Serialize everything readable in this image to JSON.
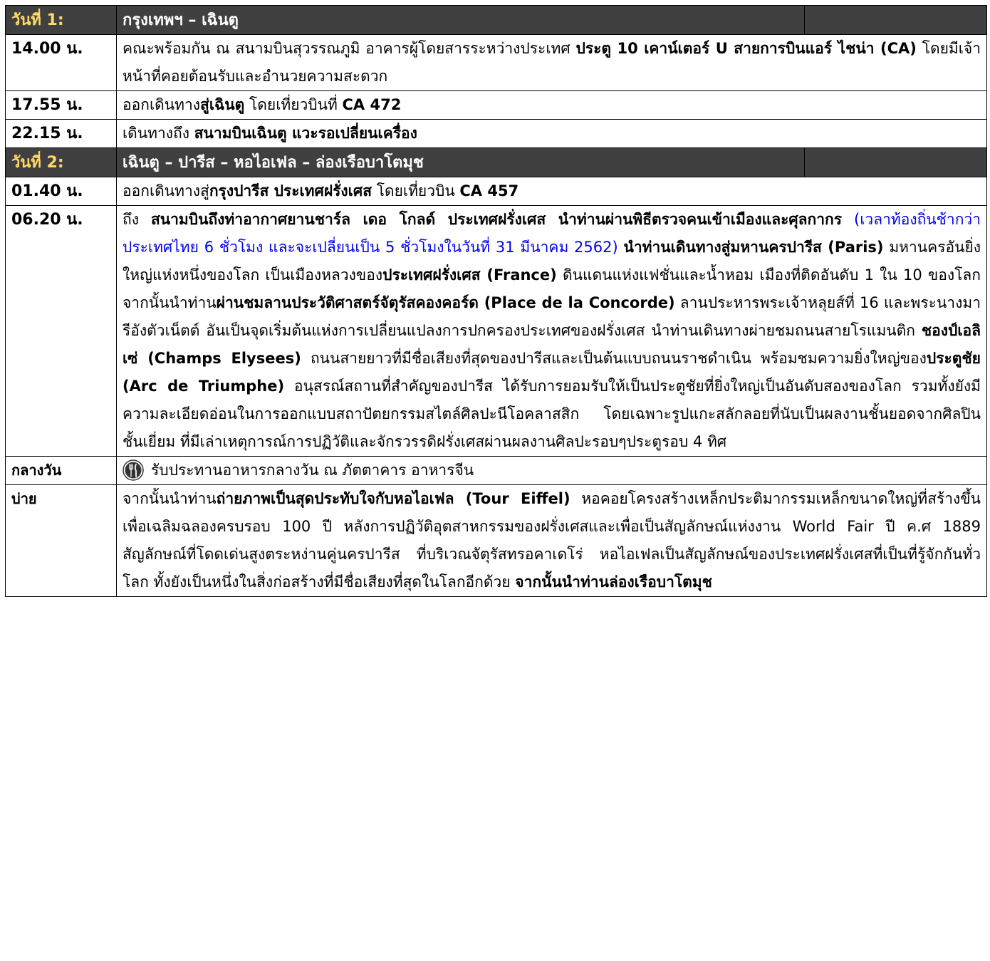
{
  "day1": {
    "label": "วันที่ 1:",
    "title": "กรุงเทพฯ – เฉินตู",
    "rows": [
      {
        "time": "14.00 น.",
        "segments": [
          {
            "t": "คณะพร้อมกัน ณ สนามบินสุวรรณภูมิ อาคารผู้โดยสารระหว่างประเทศ ",
            "s": "n"
          },
          {
            "t": "ประตู 10 เคาน์เตอร์ U สายการบินแอร์ ไชน่า (CA)",
            "s": "b"
          },
          {
            "t": " โดยมีเจ้าหน้าที่คอยต้อนรับและอำนวยความสะดวก",
            "s": "n"
          }
        ]
      },
      {
        "time": "17.55 น.",
        "segments": [
          {
            "t": "ออกเดินทาง",
            "s": "n"
          },
          {
            "t": "สู่เฉินตู",
            "s": "b"
          },
          {
            "t": " โดยเที่ยวบินที่ ",
            "s": "n"
          },
          {
            "t": "CA 472",
            "s": "b"
          }
        ]
      },
      {
        "time": "22.15 น.",
        "segments": [
          {
            "t": "เดินทางถึง ",
            "s": "n"
          },
          {
            "t": "สนามบินเฉินตู แวะรอเปลี่ยนเครื่อง",
            "s": "b"
          }
        ]
      }
    ]
  },
  "day2": {
    "label": "วันที่ 2:",
    "title": "เฉินตู – ปารีส – หอไอเฟล – ล่องเรือบาโตมุช",
    "rows": [
      {
        "time": "01.40 น.",
        "segments": [
          {
            "t": "ออกเดินทางสู่",
            "s": "n"
          },
          {
            "t": "กรุงปารีส ประเทศฝรั่งเศส",
            "s": "b"
          },
          {
            "t": " โดยเที่ยวบิน ",
            "s": "n"
          },
          {
            "t": "CA 457",
            "s": "b"
          }
        ]
      },
      {
        "time": "06.20 น.",
        "segments": [
          {
            "t": "ถึง ",
            "s": "n"
          },
          {
            "t": "สนามบินถึงท่าอากาศยานชาร์ล เดอ โกลด์ ประเทศฝรั่งเศส นำท่านผ่านพิธีตรวจคนเข้าเมืองและศุลกากร",
            "s": "b"
          },
          {
            "t": " (เวลาท้องถิ่นช้ากว่าประเทศไทย 6 ชั่วโมง และจะเปลี่ยนเป็น 5 ชั่วโมงในวันที่ 31 มีนาคม 2562)",
            "s": "blue"
          },
          {
            "t": " ",
            "s": "n"
          },
          {
            "t": "นำท่านเดินทางสู่มหานครปารีส (Paris)",
            "s": "b"
          },
          {
            "t": " มหานครอันยิ่งใหญ่แห่งหนึ่งของโลก เป็นเมืองหลวงของ",
            "s": "n"
          },
          {
            "t": "ประเทศฝรั่งเศส (France)",
            "s": "b"
          },
          {
            "t": " ดินแดนแห่งแฟชั่นและน้ำหอม เมืองที่ติดอันดับ 1 ใน 10 ของโลก จากนั้นนำท่าน",
            "s": "n"
          },
          {
            "t": "ผ่านชมลานประวัติศาสตร์จัตุรัสคองคอร์ด (Place de la Concorde)",
            "s": "b"
          },
          {
            "t": " ลานประหารพระเจ้าหลุยส์ที่ 16 และพระนางมารีอังตัวเน็ตต์ อันเป็นจุดเริ่มต้นแห่งการเปลี่ยนแปลงการปกครองประเทศของฝรั่งเศส  นำท่านเดินทางผ่ายชมถนนสายโรแมนติก ",
            "s": "n"
          },
          {
            "t": "ชองป์เอลิเซ่ (Champs Elysees)",
            "s": "b"
          },
          {
            "t": " ถนนสายยาวที่มีชื่อเสียงที่สุดของปารีสและเป็นต้นแบบถนนราชดำเนิน พร้อมชมความยิ่งใหญ่ของ",
            "s": "n"
          },
          {
            "t": "ประตูชัย (Arc de Triumphe)",
            "s": "b"
          },
          {
            "t": " อนุสรณ์สถานที่สำคัญของปารีส ได้รับการยอมรับให้เป็นประตูชัยที่ยิ่งใหญ่เป็นอันดับสองของโลก รวมทั้งยังมีความละเอียดอ่อนในการออกแบบสถาปัตยกรรมสไตล์ศิลปะนีโอคลาสสิก โดยเฉพาะรูปแกะสลักลอยที่นับเป็นผลงานชั้นยอดจากศิลปินชั้นเยี่ยม ที่มีเล่าเหตุการณ์การปฏิวัติและจักรวรรดิฝรั่งเศสผ่านผลงานศิลปะรอบๆประตูรอบ 4 ทิศ",
            "s": "n"
          }
        ]
      },
      {
        "time": "กลางวัน",
        "meal": true,
        "icon": "restaurant-icon",
        "segments": [
          {
            "t": "รับประทานอาหารกลางวัน ณ ภัตตาคาร อาหารจีน",
            "s": "n"
          }
        ]
      },
      {
        "time": "บ่าย",
        "segments": [
          {
            "t": "จากนั้นนำท่าน",
            "s": "n"
          },
          {
            "t": "ถ่ายภาพเป็นสุดประทับใจกับหอไอเฟล (Tour Eiffel)",
            "s": "b"
          },
          {
            "t": " หอคอยโครงสร้างเหล็กประติมากรรมเหล็กขนาดใหญ่ที่สร้างขึ้นเพื่อเฉลิมฉลองครบรอบ 100 ปี หลังการปฏิวัติอุตสาหกรรมของฝรั่งเศสและเพื่อเป็นสัญลักษณ์แห่งงาน World Fair ปี ค.ศ 1889 สัญลักษณ์ที่โดดเด่นสูงตระหง่านคู่นครปารีส ที่บริเวณจัตุรัสทรอคาเดโร่ หอไอเฟลเป็นสัญลักษณ์ของประเทศฝรั่งเศสที่เป็นที่รู้จักกันทั่วโลก ทั้งยังเป็นหนึ่งในสิ่งก่อสร้างที่มีชื่อเสียงที่สุดในโลกอีกด้วย  ",
            "s": "n"
          },
          {
            "t": "จากนั้นนำท่านล่องเรือบาโตมุช",
            "s": "b"
          }
        ]
      }
    ]
  }
}
